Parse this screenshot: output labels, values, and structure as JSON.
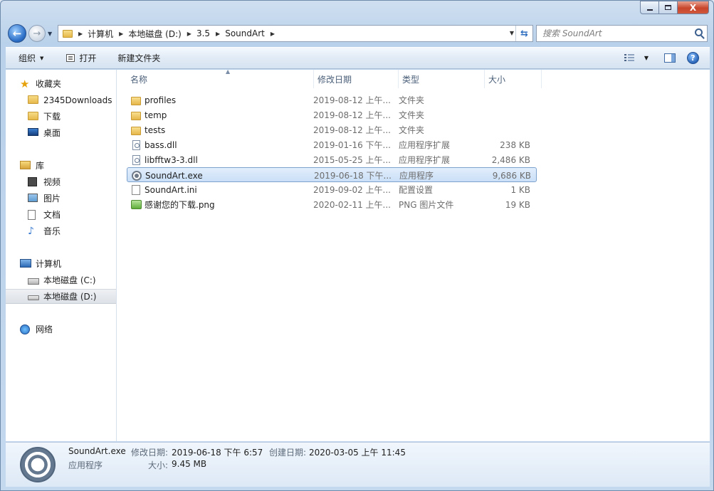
{
  "window": {
    "close_glyph": "X"
  },
  "navigation": {
    "back_glyph": "←",
    "forward_glyph": "→",
    "breadcrumb": [
      "计算机",
      "本地磁盘 (D:)",
      "3.5",
      "SoundArt"
    ],
    "search_placeholder": "搜索 SoundArt"
  },
  "commandbar": {
    "organize": "组织",
    "open": "打开",
    "new_folder": "新建文件夹",
    "help_glyph": "?"
  },
  "sidebar": {
    "favorites": {
      "title": "收藏夹",
      "items": [
        "2345Downloads",
        "下载",
        "桌面"
      ]
    },
    "libraries": {
      "title": "库",
      "items": [
        "视频",
        "图片",
        "文档",
        "音乐"
      ]
    },
    "computer": {
      "title": "计算机",
      "items": [
        "本地磁盘 (C:)",
        "本地磁盘 (D:)"
      ],
      "selected_index": 1
    },
    "network": {
      "title": "网络"
    }
  },
  "columns": {
    "name": "名称",
    "date": "修改日期",
    "type": "类型",
    "size": "大小"
  },
  "files": [
    {
      "name": "profiles",
      "date": "2019-08-12 上午...",
      "type": "文件夹",
      "size": "",
      "icon": "folder-icon"
    },
    {
      "name": "temp",
      "date": "2019-08-12 上午...",
      "type": "文件夹",
      "size": "",
      "icon": "folder-icon"
    },
    {
      "name": "tests",
      "date": "2019-08-12 上午...",
      "type": "文件夹",
      "size": "",
      "icon": "folder-icon"
    },
    {
      "name": "bass.dll",
      "date": "2019-01-16 下午...",
      "type": "应用程序扩展",
      "size": "238 KB",
      "icon": "dll-icon"
    },
    {
      "name": "libfftw3-3.dll",
      "date": "2015-05-25 上午...",
      "type": "应用程序扩展",
      "size": "2,486 KB",
      "icon": "dll-icon"
    },
    {
      "name": "SoundArt.exe",
      "date": "2019-06-18 下午...",
      "type": "应用程序",
      "size": "9,686 KB",
      "icon": "exe-icon"
    },
    {
      "name": "SoundArt.ini",
      "date": "2019-09-02 上午...",
      "type": "配置设置",
      "size": "1 KB",
      "icon": "ini-icon"
    },
    {
      "name": "感谢您的下载.png",
      "date": "2020-02-11 上午...",
      "type": "PNG 图片文件",
      "size": "19 KB",
      "icon": "png-icon"
    }
  ],
  "selected_file_index": 5,
  "details": {
    "name": "SoundArt.exe",
    "kind": "应用程序",
    "modified_label": "修改日期:",
    "modified_value": "2019-06-18 下午 6:57",
    "created_label": "创建日期:",
    "created_value": "2020-03-05 上午 11:45",
    "size_label": "大小:",
    "size_value": "9.45 MB"
  },
  "colors": {
    "selection": "#cadff7",
    "selection_border": "#7da2ce",
    "chrome": "#c4d8ee"
  }
}
